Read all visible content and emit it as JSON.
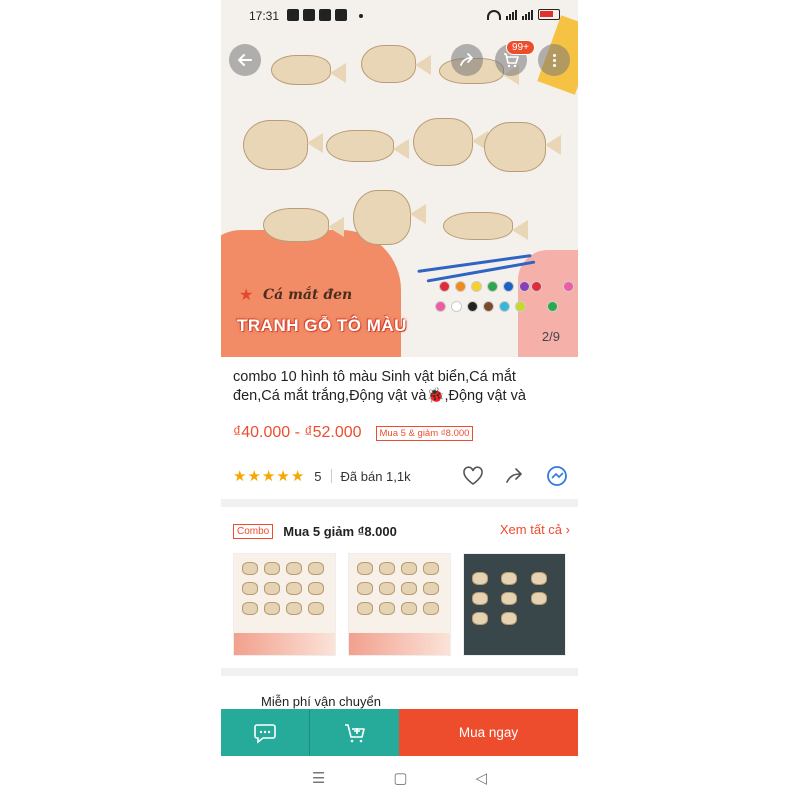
{
  "status_bar": {
    "time": "17:31"
  },
  "header": {
    "cart_badge": "99+"
  },
  "gallery": {
    "caption": "Cá mắt đen",
    "brand": "TRANH GỖ TÔ MÀU",
    "counter": "2/9",
    "paint_colors": [
      "#e22b3a",
      "#f08a1d",
      "#f6d12a",
      "#2aa84b",
      "#1d62c7",
      "#8a3fb8",
      "#ef5aa4",
      "#ffffff",
      "#222222",
      "#7b4a2a",
      "#36b6d9",
      "#c8d92a"
    ]
  },
  "product": {
    "title": "combo 10 hình tô màu Sinh vật biển,Cá mắt đen,Cá mắt trắng,Động vật và🐞,Động vật và",
    "price": "₫40.000 - ₫52.000",
    "promo": "Mua 5 & giảm ₫8.000",
    "rating": "5",
    "rating_fraction": 1.0,
    "sold": "Đã bán 1,1k"
  },
  "combo": {
    "badge": "Combo",
    "title": "Mua 5 giảm ₫8.000",
    "see_all": "Xem tất cả"
  },
  "shipping": {
    "label": "Miễn phí vận chuyển"
  },
  "bottom_bar": {
    "buy_now": "Mua ngay"
  },
  "colors": {
    "accent": "#ee4d2d",
    "teal": "#26aa99",
    "star": "#f6a700"
  },
  "icons": [
    "back-arrow-icon",
    "share-icon",
    "cart-icon",
    "more-icon",
    "heart-icon",
    "messenger-icon",
    "chat-icon",
    "add-to-cart-icon"
  ]
}
